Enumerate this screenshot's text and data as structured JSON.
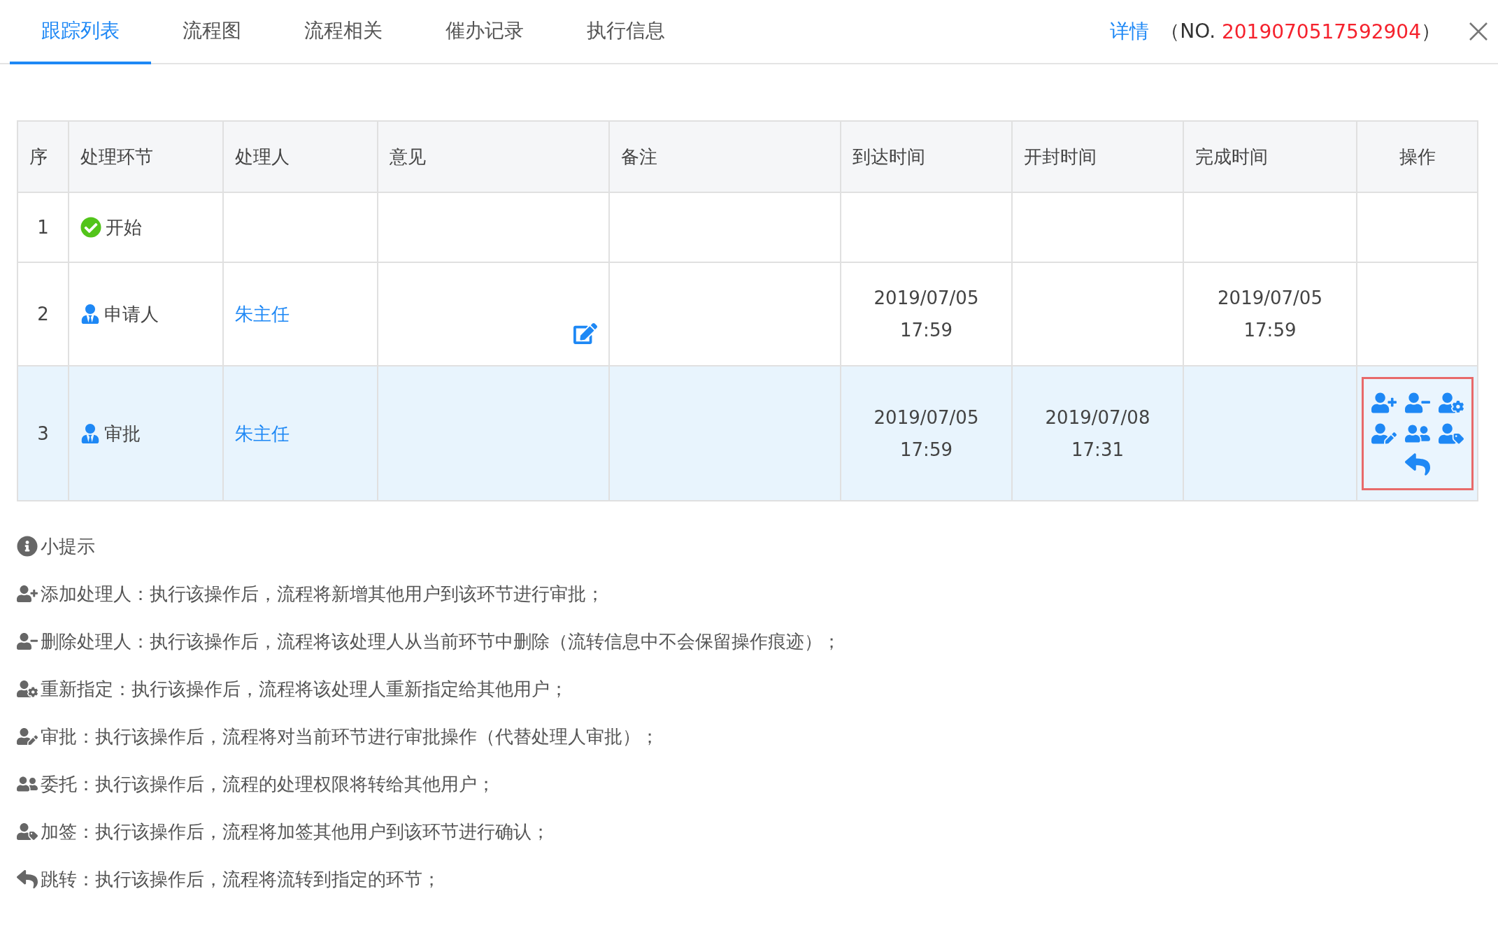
{
  "tabs": [
    {
      "label": "跟踪列表",
      "selected": true
    },
    {
      "label": "流程图",
      "selected": false
    },
    {
      "label": "流程相关",
      "selected": false
    },
    {
      "label": "催办记录",
      "selected": false
    },
    {
      "label": "执行信息",
      "selected": false
    }
  ],
  "header": {
    "detail_link": "详情",
    "number_prefix": "（NO.",
    "number": "2019070517592904",
    "number_suffix": "）"
  },
  "table": {
    "columns": [
      "序",
      "处理环节",
      "处理人",
      "意见",
      "备注",
      "到达时间",
      "开封时间",
      "完成时间",
      "操作"
    ],
    "rows": [
      {
        "seq": "1",
        "step": {
          "kind": "start",
          "label": "开始"
        },
        "handler": "",
        "opinion_editable": false,
        "arrival": [],
        "opened": [],
        "completed": [],
        "selected": false,
        "actions": []
      },
      {
        "seq": "2",
        "step": {
          "kind": "person",
          "label": "申请人"
        },
        "handler": "朱主任",
        "opinion_editable": true,
        "arrival": [
          "2019/07/05",
          "17:59"
        ],
        "opened": [],
        "completed": [
          "2019/07/05",
          "17:59"
        ],
        "selected": false,
        "actions": []
      },
      {
        "seq": "3",
        "step": {
          "kind": "person",
          "label": "审批"
        },
        "handler": "朱主任",
        "opinion_editable": false,
        "arrival": [
          "2019/07/05",
          "17:59"
        ],
        "opened": [
          "2019/07/08",
          "17:31"
        ],
        "completed": [],
        "selected": true,
        "actions_highlighted": true,
        "actions": [
          {
            "kind": "add"
          },
          {
            "kind": "remove"
          },
          {
            "kind": "reassign"
          },
          {
            "kind": "approve"
          },
          {
            "kind": "delegate"
          },
          {
            "kind": "countersign"
          },
          {
            "kind": "jump"
          }
        ]
      }
    ]
  },
  "tips": {
    "title": "小提示",
    "items": [
      {
        "kind": "add",
        "text": "添加处理人：执行该操作后，流程将新增其他用户到该环节进行审批；"
      },
      {
        "kind": "remove",
        "text": "删除处理人：执行该操作后，流程将该处理人从当前环节中删除（流转信息中不会保留操作痕迹）；"
      },
      {
        "kind": "reassign",
        "text": "重新指定：执行该操作后，流程将该处理人重新指定给其他用户；"
      },
      {
        "kind": "approve",
        "text": "审批：执行该操作后，流程将对当前环节进行审批操作（代替处理人审批）；"
      },
      {
        "kind": "delegate",
        "text": "委托：执行该操作后，流程的处理权限将转给其他用户；"
      },
      {
        "kind": "countersign",
        "text": "加签：执行该操作后，流程将加签其他用户到该环节进行确认；"
      },
      {
        "kind": "jump",
        "text": "跳转：执行该操作后，流程将流转到指定的环节；"
      }
    ]
  }
}
